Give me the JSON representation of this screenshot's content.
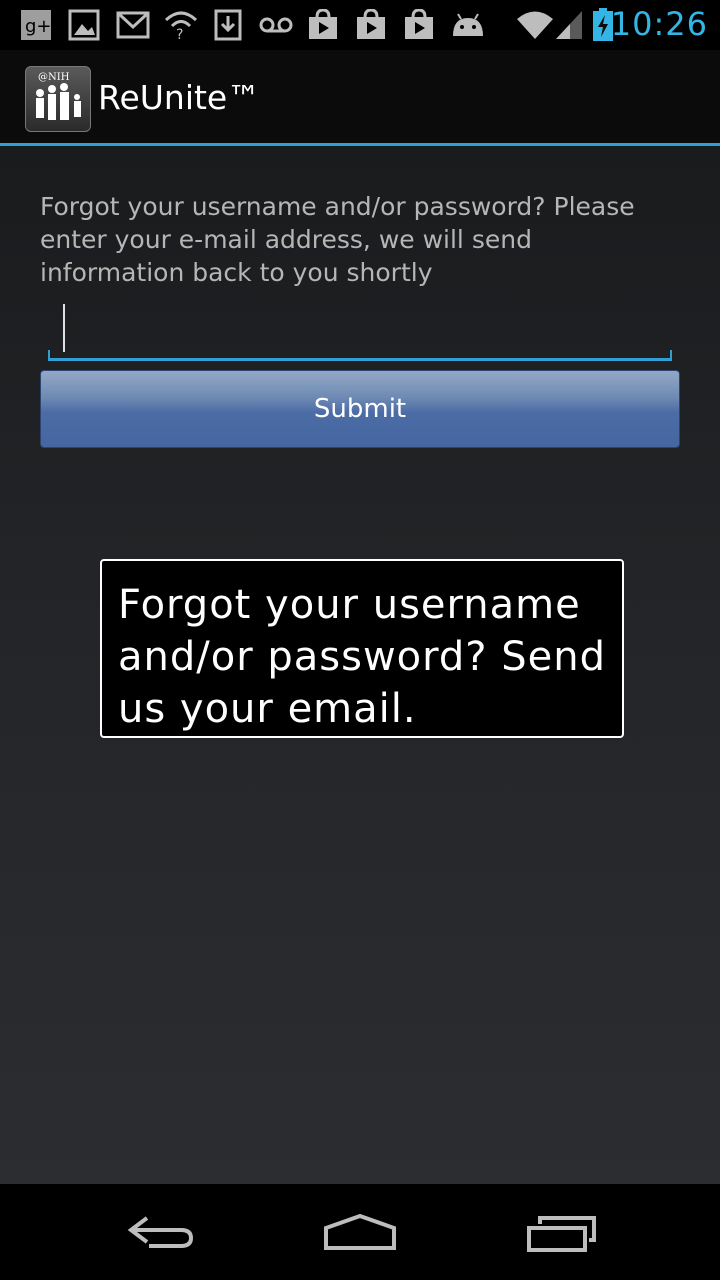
{
  "status_bar": {
    "time": "10:26",
    "icons": [
      "google-plus-icon",
      "gallery-icon",
      "gmail-icon",
      "wifi-question-icon",
      "download-icon",
      "voicemail-icon",
      "play-store-icon",
      "play-store-icon",
      "play-store-icon",
      "android-icon",
      "wifi-icon",
      "signal-icon",
      "battery-charging-icon"
    ],
    "accent": "#33b5e5"
  },
  "action_bar": {
    "app_name": "ReUnite™",
    "icon_label": "@NIH",
    "accent": "#2f9fd6"
  },
  "form": {
    "instructions": "Forgot your username and/or password? Please enter your e-mail address, we will send information back to you shortly",
    "email_value": "",
    "email_placeholder": "",
    "submit_label": "Submit"
  },
  "caption": {
    "text": "Forgot your username and/or password? Send us your email."
  },
  "nav_bar": {
    "buttons": [
      "back-icon",
      "home-icon",
      "recent-apps-icon"
    ]
  }
}
